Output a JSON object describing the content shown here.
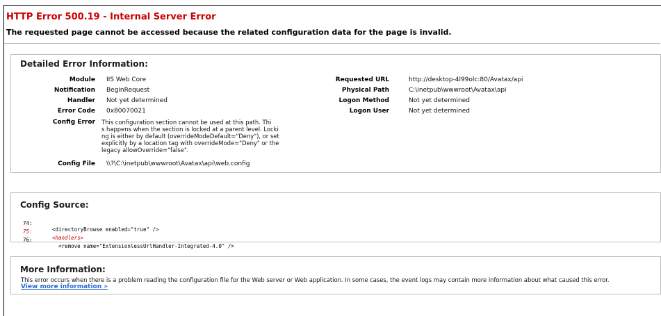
{
  "header": {
    "title": "HTTP Error 500.19 - Internal Server Error",
    "subtitle": "The requested page cannot be accessed because the related configuration data for the page is invalid."
  },
  "detail": {
    "title": "Detailed Error Information:",
    "left": [
      {
        "label": "Module",
        "value": "IIS Web Core"
      },
      {
        "label": "Notification",
        "value": "BeginRequest"
      },
      {
        "label": "Handler",
        "value": "Not yet determined"
      },
      {
        "label": "Error Code",
        "value": "0x80070021"
      }
    ],
    "config_error_label": "Config Error",
    "config_error_lines": [
      "This configuration section cannot be used at this path. Thi",
      "s happens when the section is locked at a parent level. Locki",
      "ng is either by default (overrideModeDefault=\"Deny\"), or set",
      "explicitly by a location tag with overrideMode=\"Deny\" or the",
      "legacy allowOverride=\"false\"."
    ],
    "config_file_label": "Config File",
    "config_file_value": "\\\\?\\C:\\inetpub\\wwwroot\\Avatax\\api\\web.config",
    "right": [
      {
        "label": "Requested URL",
        "value": "http://desktop-4l99olc:80/Avatax/api"
      },
      {
        "label": "Physical Path",
        "value": "C:\\inetpub\\wwwroot\\Avatax\\api"
      },
      {
        "label": "Logon Method",
        "value": "Not yet determined"
      },
      {
        "label": "Logon User",
        "value": "Not yet determined"
      }
    ]
  },
  "config_source": {
    "title": "Config Source:",
    "lines": [
      {
        "num": "74:",
        "text": "<directoryBrowse enabled=\"true\" />",
        "highlight": false
      },
      {
        "num": "75:",
        "text": "<handlers>",
        "highlight": true
      },
      {
        "num": "76:",
        "text": "  <remove name=\"ExtensionlessUrlHandler-Integrated-4.0\" />",
        "highlight": false
      }
    ]
  },
  "more_info": {
    "title": "More Information:",
    "text": "This error occurs when there is a problem reading the configuration file for the Web server or Web application. In some cases, the event logs may contain more information about what caused this error.",
    "link": "View more information »"
  },
  "colors": {
    "error_red": "#cc0000",
    "link_blue": "#2b6bd4",
    "highlight_red": "#c00000"
  }
}
